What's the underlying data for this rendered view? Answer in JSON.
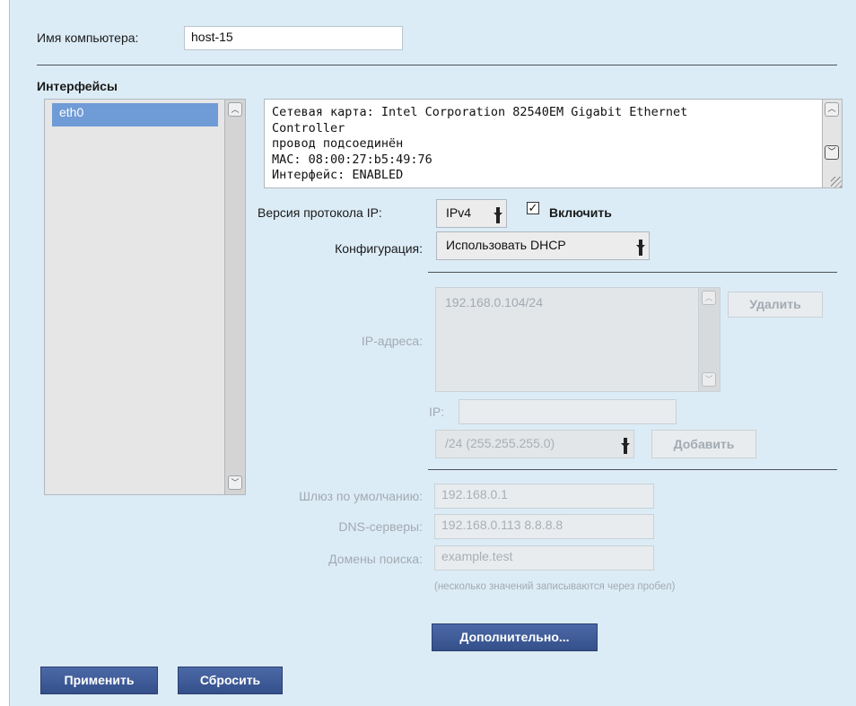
{
  "hostname": {
    "label": "Имя компьютера:",
    "value": "host-15"
  },
  "interfaces": {
    "title": "Интерфейсы",
    "items": [
      {
        "label": "eth0",
        "selected": true
      }
    ]
  },
  "info": {
    "lines": [
      "Сетевая карта: Intel Corporation 82540EM Gigabit Ethernet",
      "Controller",
      "провод подсоединён",
      "MAC: 08:00:27:b5:49:76",
      "Интерфейс: ENABLED"
    ]
  },
  "protocol": {
    "label": "Версия протокола IP:",
    "value": "IPv4",
    "enable_label": "Включить",
    "enabled": true
  },
  "config": {
    "label": "Конфигурация:",
    "value": "Использовать DHCP"
  },
  "ip_addresses": {
    "label": "IP-адреса:",
    "items": [
      "192.168.0.104/24"
    ],
    "delete_label": "Удалить",
    "ip_label": "IP:",
    "ip_value": "",
    "mask_value": "/24 (255.255.255.0)",
    "add_label": "Добавить"
  },
  "gateway": {
    "label": "Шлюз по умолчанию:",
    "value": "192.168.0.1"
  },
  "dns": {
    "label": "DNS-серверы:",
    "value": "192.168.0.113 8.8.8.8"
  },
  "search": {
    "label": "Домены поиска:",
    "value": "example.test"
  },
  "hint": "(несколько значений записываются через пробел)",
  "buttons": {
    "advanced": "Дополнительно...",
    "apply": "Применить",
    "reset": "Сбросить"
  },
  "colors": {
    "panel": "#dcecf6",
    "primary_button": "#3b5998",
    "selection": "#6f9bd6",
    "disabled_text": "#a2aab2"
  }
}
